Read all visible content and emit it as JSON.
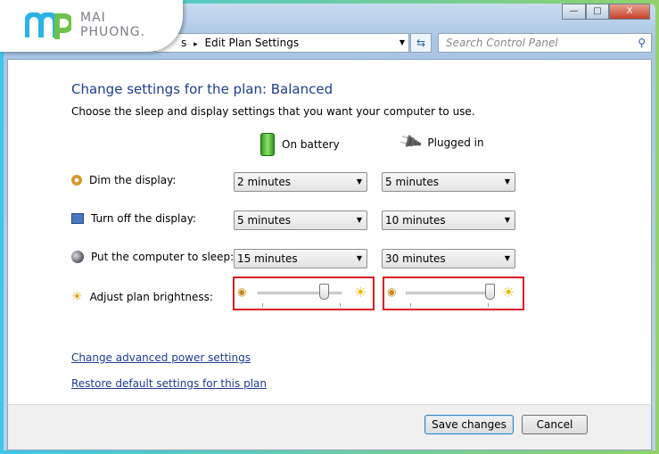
{
  "logo": {
    "line1": "MAI",
    "line2": "PHUONG."
  },
  "window": {
    "minimize": "—",
    "maximize": "□",
    "close": "X"
  },
  "address": {
    "path_prev": "s",
    "path_current": "Edit Plan Settings",
    "separator": "▸"
  },
  "search": {
    "placeholder": "Search Control Panel"
  },
  "main": {
    "title": "Change settings for the plan: Balanced",
    "subtitle": "Choose the sleep and display settings that you want your computer to use.",
    "columns": [
      {
        "label": "On battery",
        "icon": "battery-icon"
      },
      {
        "label": "Plugged in",
        "icon": "plug-icon"
      }
    ],
    "rows": [
      {
        "label": "Dim the display:",
        "icon": "dim-display-icon",
        "battery": "2 minutes",
        "plugged": "5 minutes"
      },
      {
        "label": "Turn off the display:",
        "icon": "display-clock-icon",
        "battery": "5 minutes",
        "plugged": "10 minutes"
      },
      {
        "label": "Put the computer to sleep:",
        "icon": "sleep-moon-icon",
        "battery": "15 minutes",
        "plugged": "30 minutes"
      }
    ],
    "brightness": {
      "label": "Adjust plan brightness:",
      "battery_percent": 79,
      "plugged_percent": 100
    },
    "links": [
      "Change advanced power settings",
      "Restore default settings for this plan"
    ]
  },
  "footer": {
    "save": "Save changes",
    "cancel": "Cancel"
  },
  "colors": {
    "highlight": "#e01b24",
    "title": "#1e3d8f"
  }
}
